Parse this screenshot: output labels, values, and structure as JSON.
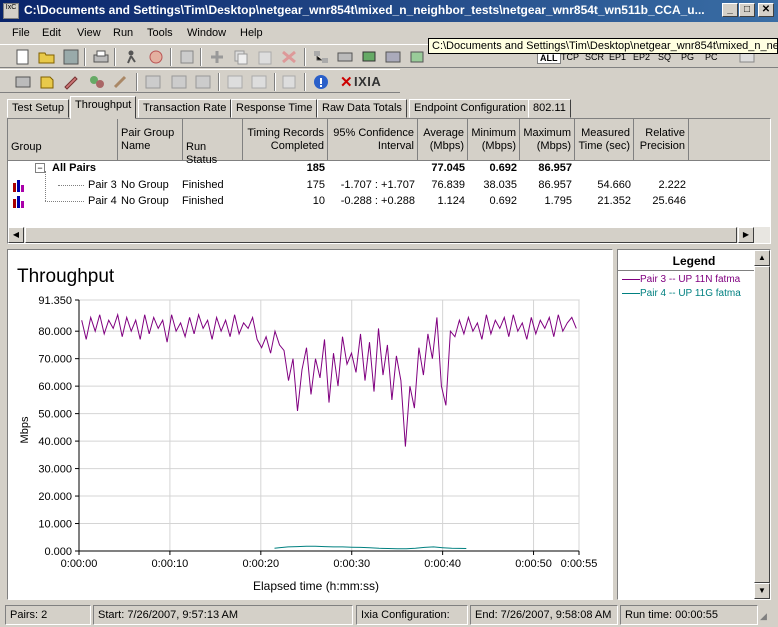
{
  "window": {
    "title": "C:\\Documents and Settings\\Tim\\Desktop\\netgear_wnr854t\\mixed_n_neighbor_tests\\netgear_wnr854t_wn511b_CCA_u...",
    "icon_text": "IxC",
    "minimize": "_",
    "maximize": "□",
    "close": "✕"
  },
  "menu": [
    "File",
    "Edit",
    "View",
    "Run",
    "Tools",
    "Window",
    "Help"
  ],
  "tooltip": "C:\\Documents and Settings\\Tim\\Desktop\\netgear_wnr854t\\mixed_n_neighbor_tests\\",
  "filter_tabs": [
    "ALL",
    "TCP",
    "SCR",
    "EP1",
    "EP2",
    "SQ",
    "PG",
    "PC"
  ],
  "ixia_logo": "IXIA",
  "tabs": [
    "Test Setup",
    "Throughput",
    "Transaction Rate",
    "Response Time",
    "Raw Data Totals",
    "Endpoint Configuration",
    "802.11"
  ],
  "active_tab": "Throughput",
  "table": {
    "headers": {
      "group": "Group",
      "pair_group_name": "Pair Group Name",
      "run_status": "Run Status",
      "timing_records": "Timing Records Completed",
      "confidence": "95% Confidence Interval",
      "average": "Average (Mbps)",
      "minimum": "Minimum (Mbps)",
      "maximum": "Maximum (Mbps)",
      "measured_time": "Measured Time (sec)",
      "relative_precision": "Relative Precision"
    },
    "summary": {
      "label": "All Pairs",
      "expander": "−",
      "records": "185",
      "average": "77.045",
      "minimum": "0.692",
      "maximum": "86.957"
    },
    "rows": [
      {
        "name": "Pair 3",
        "group": "No Group",
        "status": "Finished",
        "records": "175",
        "confidence": "-1.707 : +1.707",
        "average": "76.839",
        "minimum": "38.035",
        "maximum": "86.957",
        "time": "54.660",
        "precision": "2.222"
      },
      {
        "name": "Pair 4",
        "group": "No Group",
        "status": "Finished",
        "records": "10",
        "confidence": "-0.288 : +0.288",
        "average": "1.124",
        "minimum": "0.692",
        "maximum": "1.795",
        "time": "21.352",
        "precision": "25.646"
      }
    ]
  },
  "legend": {
    "title": "Legend",
    "items": [
      {
        "label": "Pair 3 -- UP 11N fatma",
        "color": "#800080"
      },
      {
        "label": "Pair 4 -- UP 11G fatma",
        "color": "#008080"
      }
    ]
  },
  "status": {
    "pairs": "Pairs: 2",
    "start": "Start: 7/26/2007, 9:57:13 AM",
    "ixia_config": "Ixia Configuration:",
    "end": "End: 7/26/2007, 9:58:08 AM",
    "run_time": "Run time: 00:00:55"
  },
  "chart_data": {
    "type": "line",
    "title": "Throughput",
    "xlabel": "Elapsed time (h:mm:ss)",
    "ylabel": "Mbps",
    "ylim": [
      0,
      91.35
    ],
    "xlim": [
      0,
      55
    ],
    "y_ticks": [
      "0.000",
      "10.000",
      "20.000",
      "30.000",
      "40.000",
      "50.000",
      "60.000",
      "70.000",
      "80.000",
      "91.350"
    ],
    "y_tick_values": [
      0,
      10,
      20,
      30,
      40,
      50,
      60,
      70,
      80,
      91.35
    ],
    "x_ticks": [
      "0:00:00",
      "0:00:10",
      "0:00:20",
      "0:00:30",
      "0:00:40",
      "0:00:50",
      "0:00:55"
    ],
    "x_tick_values": [
      0,
      10,
      20,
      30,
      40,
      50,
      55
    ],
    "series": [
      {
        "name": "Pair 3 -- UP 11N fatma",
        "color": "#800080",
        "x": [
          0,
          0.5,
          1,
          1.5,
          2,
          2.5,
          3,
          3.5,
          4,
          4.5,
          5,
          5.5,
          6,
          6.5,
          7,
          7.5,
          8,
          8.5,
          9,
          9.5,
          10,
          10.5,
          11,
          11.5,
          12,
          12.5,
          13,
          13.5,
          14,
          14.5,
          15,
          15.5,
          16,
          16.5,
          17,
          17.5,
          18,
          18.5,
          19,
          19.5,
          20,
          20.5,
          21,
          21.5,
          22,
          22.5,
          23,
          23.5,
          24,
          24.5,
          25,
          25.5,
          26,
          26.5,
          27,
          27.5,
          28,
          28.5,
          29,
          29.5,
          30,
          30.5,
          31,
          31.5,
          32,
          32.5,
          33,
          33.5,
          34,
          34.5,
          35,
          35.5,
          36,
          36.5,
          37,
          37.5,
          38,
          38.5,
          39,
          39.5,
          40,
          40.5,
          41,
          41.5,
          42,
          42.5,
          43,
          43.5,
          44,
          44.5,
          45,
          45.5,
          46,
          46.5,
          47,
          47.5,
          48,
          48.5,
          49,
          49.5,
          50,
          50.5,
          51,
          51.5,
          52,
          52.5,
          53,
          53.5,
          54,
          54.5,
          55
        ],
        "values": [
          84,
          77,
          85,
          80,
          86,
          79,
          84,
          81,
          86,
          78,
          85,
          80,
          84,
          77,
          86,
          79,
          85,
          81,
          84,
          76,
          86,
          80,
          83,
          78,
          85,
          79,
          86,
          81,
          84,
          77,
          85,
          80,
          84,
          78,
          86,
          79,
          83,
          81,
          85,
          77,
          74,
          78,
          72,
          80,
          75,
          73,
          62,
          70,
          51,
          66,
          74,
          57,
          70,
          63,
          77,
          54,
          72,
          60,
          78,
          68,
          72,
          65,
          79,
          62,
          76,
          58,
          81,
          64,
          75,
          55,
          71,
          62,
          38,
          60,
          52,
          74,
          64,
          79,
          70,
          85,
          60,
          53,
          80,
          78,
          84,
          79,
          85,
          80,
          83,
          77,
          86,
          79,
          84,
          81,
          85,
          78,
          86,
          80,
          83,
          77,
          85,
          79,
          84,
          81,
          85,
          78,
          86,
          80,
          83,
          85,
          81
        ],
        "x_start": 0.3,
        "x_end": 54.7
      },
      {
        "name": "Pair 4 -- UP 11G fatma",
        "color": "#008080",
        "x": [
          21.5,
          22,
          23,
          24,
          25,
          26,
          27,
          28,
          29,
          30,
          31,
          32,
          33,
          34,
          35,
          36,
          37,
          38,
          39,
          40,
          41,
          42.6
        ],
        "values": [
          1.0,
          1.2,
          1.5,
          1.6,
          1.7,
          1.7,
          1.6,
          1.5,
          1.5,
          1.4,
          1.3,
          1.2,
          1.0,
          0.9,
          0.8,
          0.8,
          1.0,
          1.3,
          1.5,
          1.2,
          1.0,
          0.9
        ]
      }
    ]
  }
}
